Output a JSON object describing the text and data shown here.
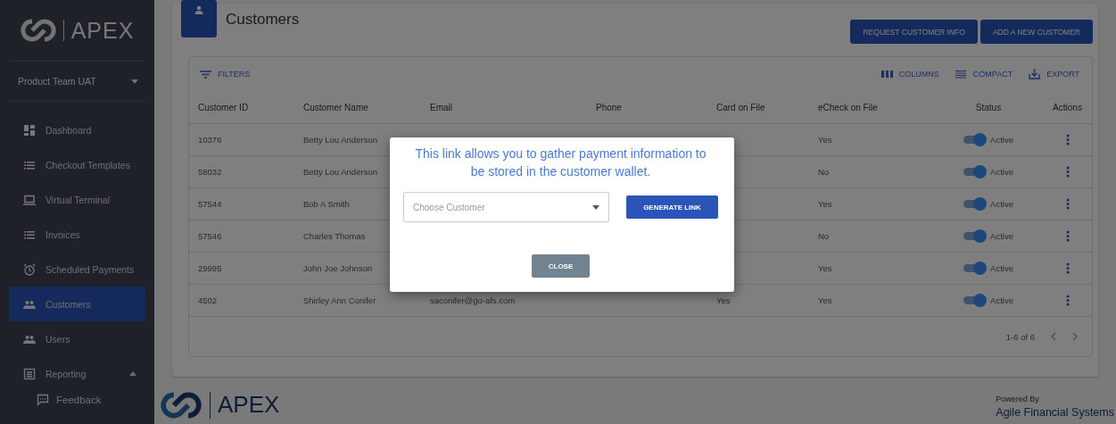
{
  "sidebar": {
    "logo": "APEX",
    "account": {
      "label": "Product Team UAT"
    },
    "items": [
      {
        "label": "Dashboard",
        "kind": "dashboard",
        "selected": false
      },
      {
        "label": "Checkout Templates",
        "kind": "list",
        "selected": false
      },
      {
        "label": "Virtual Terminal",
        "kind": "laptop",
        "selected": false
      },
      {
        "label": "Invoices",
        "kind": "list",
        "selected": false
      },
      {
        "label": "Scheduled Payments",
        "kind": "alarm",
        "selected": false
      },
      {
        "label": "Customers",
        "kind": "people",
        "selected": true
      },
      {
        "label": "Users",
        "kind": "people",
        "selected": false
      },
      {
        "label": "Reporting",
        "kind": "report",
        "selected": false,
        "expanded": true,
        "children": [
          {
            "label": "Feedback",
            "kind": "chat",
            "selected": false
          }
        ]
      }
    ]
  },
  "page": {
    "title": "Customers",
    "buttons": [
      "REQUEST CUSTOMER INFO",
      "ADD A NEW CUSTOMER"
    ]
  },
  "toolbar": {
    "filters": "FILTERS",
    "tools": [
      {
        "label": "COLUMNS",
        "kind": "columns"
      },
      {
        "label": "COMPACT",
        "kind": "compact"
      },
      {
        "label": "EXPORT",
        "kind": "export"
      }
    ]
  },
  "table": {
    "columns": [
      "Customer ID",
      "Customer Name",
      "Email",
      "Phone",
      "Card on File",
      "eCheck on File",
      "Status",
      "Actions"
    ],
    "rows": [
      {
        "id": "10376",
        "name": "Betty Lou Anderson",
        "echeck": "Yes",
        "status": "Active",
        "active": true
      },
      {
        "id": "58032",
        "name": "Betty Lou Anderson",
        "echeck": "No",
        "status": "Active",
        "active": true
      },
      {
        "id": "57544",
        "name": "Bob A Smith",
        "echeck": "Yes",
        "status": "Active",
        "active": true
      },
      {
        "id": "57546",
        "name": "Charles Thomas",
        "echeck": "No",
        "status": "Active",
        "active": true
      },
      {
        "id": "29995",
        "name": "John Joe Johnson",
        "echeck": "Yes",
        "status": "Active",
        "active": true
      },
      {
        "id": "4502",
        "name": "Shirley Ann Conifer",
        "email": "saconifer@go-afs.com",
        "card": "Yes",
        "echeck": "Yes",
        "status": "Active",
        "active": true
      }
    ],
    "pagination": "1-6 of 6"
  },
  "modal": {
    "message": "This link allows you to gather payment information to be stored in the customer wallet.",
    "select": {
      "placeholder": "Choose Customer"
    },
    "generate_button": "GENERATE LINK",
    "close_button": "CLOSE"
  },
  "footer": {
    "logo": "APEX",
    "powered_by": "Powered By",
    "company": "Agile Financial Systems"
  }
}
